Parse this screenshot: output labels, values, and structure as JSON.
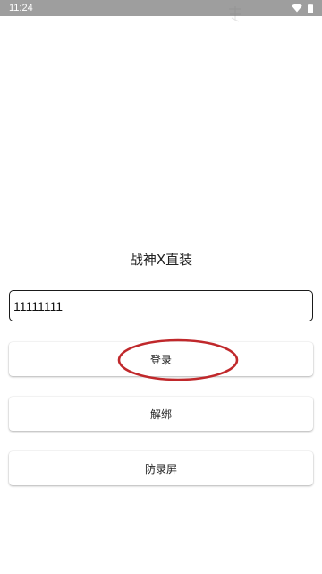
{
  "status_bar": {
    "time": "11:24",
    "icons": [
      "wifi-icon",
      "battery-icon"
    ]
  },
  "app": {
    "title": "战神X直装"
  },
  "code_input": {
    "value": "11111111",
    "placeholder": ""
  },
  "buttons": {
    "login": "登录",
    "unbind": "解绑",
    "anti_record": "防录屏"
  },
  "annotation": {
    "color": "#c0282b"
  }
}
